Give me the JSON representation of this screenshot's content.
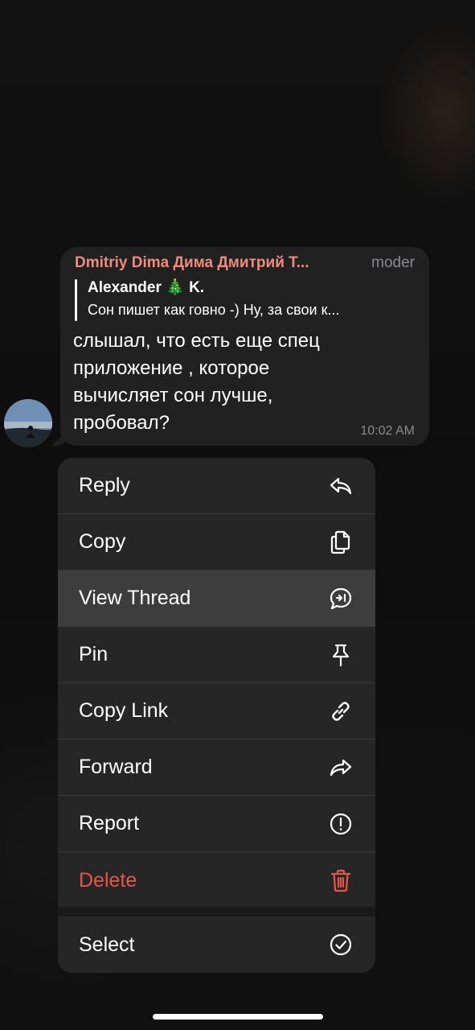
{
  "message": {
    "sender_name": "Dmitriy Dima Дима Дмитрий Т...",
    "sender_role": "moder",
    "reply": {
      "author": "Alexander 🎄 K.",
      "text": "Сон пишет как говно -) Ну, за свои к..."
    },
    "text": "слышал, что есть еще спец\nприложение , которое\nвычисляет сон лучше,\nпробовал?",
    "time": "10:02 AM"
  },
  "menu": {
    "items": [
      {
        "label": "Reply",
        "icon": "reply-icon"
      },
      {
        "label": "Copy",
        "icon": "copy-icon"
      },
      {
        "label": "View Thread",
        "icon": "thread-icon",
        "highlighted": true
      },
      {
        "label": "Pin",
        "icon": "pin-icon"
      },
      {
        "label": "Copy Link",
        "icon": "link-icon"
      },
      {
        "label": "Forward",
        "icon": "forward-icon"
      },
      {
        "label": "Report",
        "icon": "report-icon"
      },
      {
        "label": "Delete",
        "icon": "trash-icon",
        "destructive": true
      },
      {
        "label": "Select",
        "icon": "checkmark-circle-icon"
      }
    ]
  },
  "colors": {
    "sender_name": "#f08a7c",
    "destructive": "#e5564a",
    "bubble": "#212121",
    "menu_background": "#262626",
    "menu_highlight": "#3d3d3d"
  }
}
